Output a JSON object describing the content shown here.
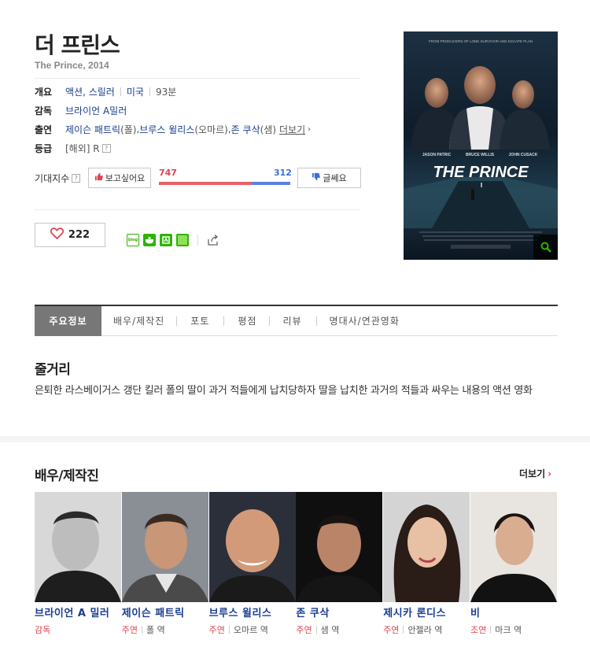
{
  "movie": {
    "title": "더 프린스",
    "subtitle": "The Prince, 2014"
  },
  "info": {
    "overview_label": "개요",
    "genre": "액션, 스릴러",
    "country": "미국",
    "runtime": "93분",
    "director_label": "감독",
    "director": "브라이언 A밀러",
    "cast_label": "출연",
    "cast_1_name": "제이슨 패트릭",
    "cast_1_role": "(폴)",
    "cast_sep_1": ", ",
    "cast_2_name": "브루스 윌리스",
    "cast_2_role": "(오마르)",
    "cast_sep_2": ", ",
    "cast_3_name": "존 쿠삭",
    "cast_3_role": "(샘)",
    "more_label": "더보기",
    "rating_label": "등급",
    "rating": "[해외] R"
  },
  "expectation": {
    "label": "기대지수",
    "want_button": "보고싶어요",
    "meh_button": "글쎄요",
    "want_count": "747",
    "meh_count": "312",
    "want_fraction": 0.705
  },
  "like": {
    "count": "222"
  },
  "share": {
    "blog_label": "blog"
  },
  "poster": {
    "tagline": "FROM PRODUCERS OF LONE SURVIVOR AND ESCAPE PLAN",
    "actor_1": "JASON PATRIC",
    "actor_2": "BRUCE WILLIS",
    "actor_3": "JOHN CUSACK",
    "logo": "THE PRINCE"
  },
  "tabs": [
    {
      "label": "주요정보"
    },
    {
      "label": "배우/제작진"
    },
    {
      "label": "포토"
    },
    {
      "label": "평점"
    },
    {
      "label": "리뷰"
    },
    {
      "label": "명대사/연관영화"
    }
  ],
  "synopsis": {
    "heading": "줄거리",
    "text": "은퇴한 라스베이거스 갱단 킬러 폴의 딸이 과거 적들에게 납치당하자 딸을 납치한 과거의 적들과 싸우는 내용의 액션 영화"
  },
  "cast_section": {
    "heading": "배우/제작진",
    "more": "더보기",
    "people": [
      {
        "name": "브라이언 A 밀러",
        "role": "감독",
        "character": ""
      },
      {
        "name": "제이슨 패트릭",
        "role": "주연",
        "character": "폴 역"
      },
      {
        "name": "브루스 윌리스",
        "role": "주연",
        "character": "오마르 역"
      },
      {
        "name": "존 쿠삭",
        "role": "주연",
        "character": "샘 역"
      },
      {
        "name": "제시카 론디스",
        "role": "주연",
        "character": "안젤라 역"
      },
      {
        "name": "비",
        "role": "조연",
        "character": "마크 역"
      }
    ]
  },
  "colors": {
    "link": "#1a3d8f",
    "want": "#e0434f",
    "meh": "#3d6fd6",
    "active_tab": "#777777"
  }
}
